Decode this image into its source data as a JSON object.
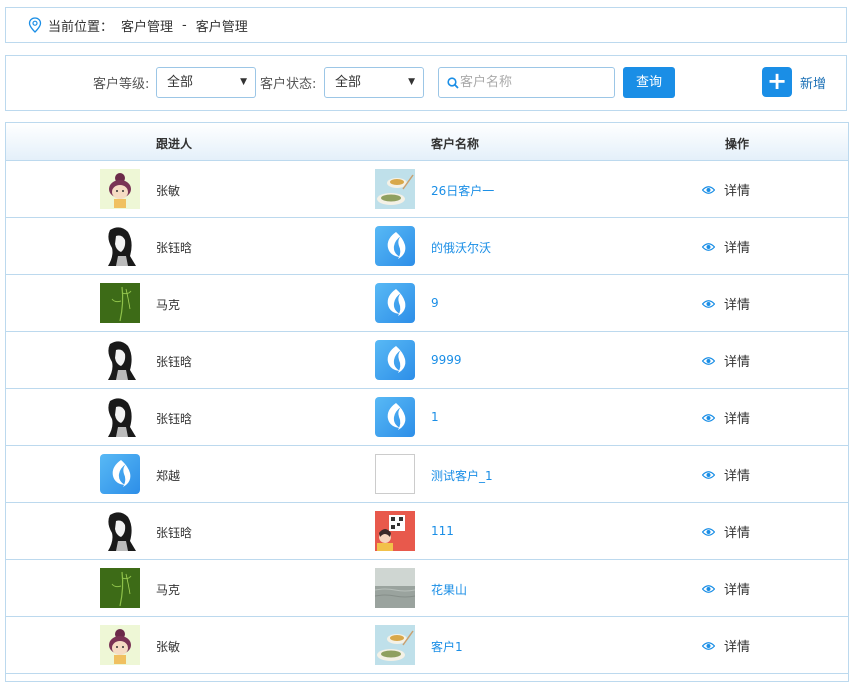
{
  "breadcrumb": {
    "prefix": "当前位置：",
    "level1": "客户管理",
    "separator": "-",
    "level2": "客户管理"
  },
  "filters": {
    "level_label": "客户等级:",
    "level_value": "全部",
    "status_label": "客户状态:",
    "status_value": "全部",
    "search_placeholder": "客户名称",
    "query_button": "查询",
    "add_label": "新增"
  },
  "table": {
    "headers": {
      "follower": "跟进人",
      "customer": "客户名称",
      "action": "操作"
    },
    "rows": [
      {
        "follower": "张敏",
        "follower_avatar": "girl-avatar",
        "customer": "26日客户一",
        "customer_avatar": "food-image",
        "action": "详情"
      },
      {
        "follower": "张钰晗",
        "follower_avatar": "ink-portrait-avatar",
        "customer": "的俄沃尔沃",
        "customer_avatar": "blue-logo",
        "action": "详情"
      },
      {
        "follower": "马克",
        "follower_avatar": "green-plant-avatar",
        "customer": "9",
        "customer_avatar": "blue-logo",
        "action": "详情"
      },
      {
        "follower": "张钰晗",
        "follower_avatar": "ink-portrait-avatar",
        "customer": "9999",
        "customer_avatar": "blue-logo",
        "action": "详情"
      },
      {
        "follower": "张钰晗",
        "follower_avatar": "ink-portrait-avatar",
        "customer": "1",
        "customer_avatar": "blue-logo",
        "action": "详情"
      },
      {
        "follower": "郑越",
        "follower_avatar": "blue-logo",
        "customer": "测试客户_1",
        "customer_avatar": "blank-image",
        "action": "详情"
      },
      {
        "follower": "张钰晗",
        "follower_avatar": "ink-portrait-avatar",
        "customer": "111",
        "customer_avatar": "red-qr-image",
        "action": "详情"
      },
      {
        "follower": "马克",
        "follower_avatar": "green-plant-avatar",
        "customer": "花果山",
        "customer_avatar": "sea-image",
        "action": "详情"
      },
      {
        "follower": "张敏",
        "follower_avatar": "girl-avatar",
        "customer": "客户1",
        "customer_avatar": "food-image",
        "action": "详情"
      }
    ]
  },
  "colors": {
    "accent": "#1a8ee6",
    "border": "#bcd9ee",
    "link": "#1a8ee6"
  }
}
